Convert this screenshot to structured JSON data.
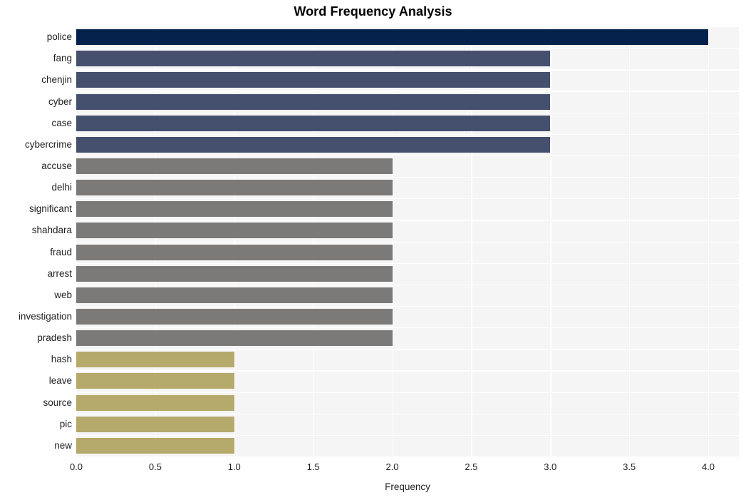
{
  "chart_data": {
    "type": "bar",
    "orientation": "horizontal",
    "title": "Word Frequency Analysis",
    "xlabel": "Frequency",
    "ylabel": "",
    "xlim": [
      0.0,
      4.0
    ],
    "xticks": [
      "0.0",
      "0.5",
      "1.0",
      "1.5",
      "2.0",
      "2.5",
      "3.0",
      "3.5",
      "4.0"
    ],
    "xtick_values": [
      0.0,
      0.5,
      1.0,
      1.5,
      2.0,
      2.5,
      3.0,
      3.5,
      4.0
    ],
    "grid": true,
    "legend": "none",
    "categories": [
      "police",
      "fang",
      "chenjin",
      "cyber",
      "case",
      "cybercrime",
      "accuse",
      "delhi",
      "significant",
      "shahdara",
      "fraud",
      "arrest",
      "web",
      "investigation",
      "pradesh",
      "hash",
      "leave",
      "source",
      "pic",
      "new"
    ],
    "values": [
      4,
      3,
      3,
      3,
      3,
      3,
      2,
      2,
      2,
      2,
      2,
      2,
      2,
      2,
      2,
      1,
      1,
      1,
      1,
      1
    ],
    "bar_colors": [
      "#04224c",
      "#454f6e",
      "#454f6e",
      "#454f6e",
      "#454f6e",
      "#454f6e",
      "#7b7a78",
      "#7b7a78",
      "#7b7a78",
      "#7b7a78",
      "#7b7a78",
      "#7b7a78",
      "#7b7a78",
      "#7b7a78",
      "#7b7a78",
      "#b6a96c",
      "#b6a96c",
      "#b6a96c",
      "#b6a96c",
      "#b6a96c"
    ],
    "palette": {
      "freq_4": "#04224c",
      "freq_3": "#454f6e",
      "freq_2": "#7b7a78",
      "freq_1": "#b6a96c",
      "plot_background": "#f5f5f6",
      "grid_color": "#ffffff",
      "page_background": "#ffffff",
      "text_color": "#1f1f1f"
    }
  }
}
